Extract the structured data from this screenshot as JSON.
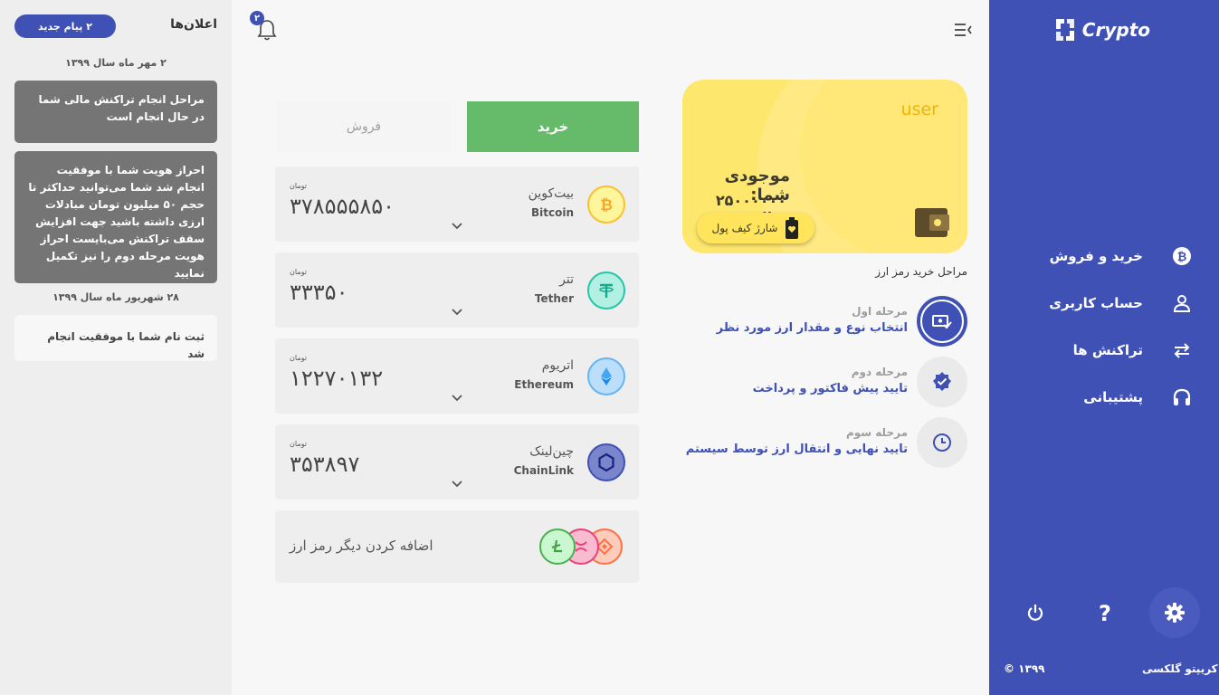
{
  "brand": {
    "logo_text": "Crypto",
    "footer_name": "کریپتو گلکسی",
    "footer_year": "© ۱۳۹۹"
  },
  "nav": {
    "items": [
      {
        "label": "خرید و فروش",
        "icon": "bitcoin-icon"
      },
      {
        "label": "حساب کاربری",
        "icon": "user-icon"
      },
      {
        "label": "تراکنش ها",
        "icon": "swap-icon"
      },
      {
        "label": "پشتیبانی",
        "icon": "headphones-icon"
      }
    ],
    "bottom_icons": [
      "power-icon",
      "help-icon",
      "settings-icon"
    ]
  },
  "notifications": {
    "count": "۲"
  },
  "wallet": {
    "user": "user",
    "balance_title": "موجودی شما:",
    "balance_amount": "۲۵۰۰۰۰۰۰ ریال",
    "charge_label": "شارژ کیف پول"
  },
  "steps": {
    "title": "مراحل خرید رمز ارز",
    "items": [
      {
        "label": "مرحله اول",
        "desc": "انتخاب نوع و مقدار ارز مورد نظر",
        "icon": "money-check-icon"
      },
      {
        "label": "مرحله دوم",
        "desc": "تایید پیش فاکتور و پرداخت",
        "icon": "verified-badge-icon"
      },
      {
        "label": "مرحله سوم",
        "desc": "تایید نهایی و انتقال ارز توسط سیستم",
        "icon": "clock-icon"
      }
    ]
  },
  "trade": {
    "buy_label": "خرید",
    "sell_label": "فروش",
    "coins": [
      {
        "name_fa": "بیت‌کوین",
        "name_en": "Bitcoin",
        "unit": "تومان",
        "price": "۳۷۸۵۵۵۸۵۰",
        "color": "#fbc02d"
      },
      {
        "name_fa": "تتر",
        "name_en": "Tether",
        "unit": "تومان",
        "price": "۳۳۳۵۰",
        "color": "#26c6a6"
      },
      {
        "name_fa": "اتریوم",
        "name_en": "Ethereum",
        "unit": "تومان",
        "price": "۱۲۲۷۰۱۳۲",
        "color": "#42a5f5"
      },
      {
        "name_fa": "چین‌لینک",
        "name_en": "ChainLink",
        "unit": "تومان",
        "price": "۳۵۳۸۹۷",
        "color": "#3f51b5"
      }
    ],
    "add_label": "اضافه کردن دیگر رمز ارز"
  },
  "announcements": {
    "title": "اعلان‌ها",
    "badge": "۲ پیام جدید",
    "groups": [
      {
        "date": "۲ مهر ماه سال ۱۳۹۹",
        "messages": [
          "مراحل انجام تراکنش مالی شما در حال انجام است",
          "احراز هویت شما با موفقیت انجام شد شما می‌توانید حداکثر تا حجم ۵۰ میلیون تومان مبادلات ارزی داشته باشید جهت افزایش سقف تراکنش می‌بایست احراز هویت مرحله دوم را نیز تکمیل نمایید"
        ]
      },
      {
        "date": "۲۸ شهریور ماه سال ۱۳۹۹",
        "messages": [
          "ثبت نام شما با موفقیت انجام شد"
        ]
      }
    ]
  }
}
